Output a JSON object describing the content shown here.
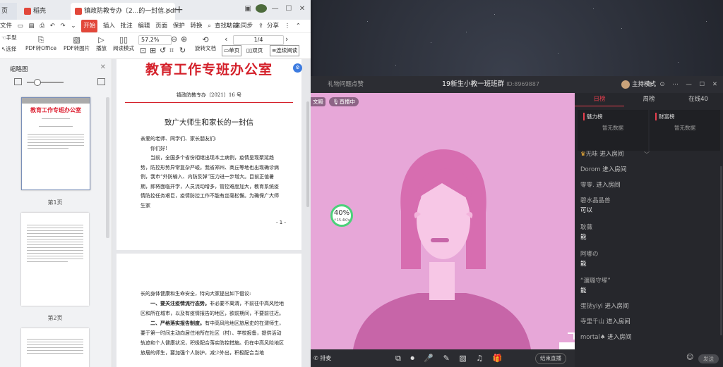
{
  "pdf_window": {
    "tabs": [
      {
        "label": "页"
      },
      {
        "label": "稻壳"
      },
      {
        "label": "镇政防教专办〔2...的一封信.pdf"
      }
    ],
    "menu": {
      "file": "文件",
      "start": "开始",
      "items": [
        "插入",
        "批注",
        "编辑",
        "页面",
        "保护",
        "转换"
      ],
      "search": "查找功能",
      "sync": "未同步",
      "share": "分享"
    },
    "toolbar": {
      "hand": "手型",
      "select": "选择",
      "pdf_to_office": "PDF转Office",
      "pdf_to_image": "PDF转图片",
      "play": "播放",
      "read_mode": "阅读模式",
      "zoom": "57.2%",
      "page": "1/4",
      "rotate": "旋转文档",
      "single": "单页",
      "double": "双页",
      "continuous": "连续阅读"
    },
    "sidebar": {
      "title": "缩略图",
      "thumb1_header": "教育工作专班办公室",
      "pages": [
        "第1页",
        "第2页"
      ]
    },
    "document": {
      "office": "教育工作专班办公室",
      "number": "镇政防教专办〔2021〕16 号",
      "title": "致广大师生和家长的一封信",
      "salutation": "亲爱的老师、同学们、家长朋友们:",
      "greeting": "你们好!",
      "para": "当前，全国多个省份相继出现本土病例，疫情呈现聚延趋势，防控形势异常复杂严峻。我省郑州、商丘等地也出现确诊病例，我市“外防输入、内防反弹”压力进一步增大。目前正值暑期，即将面临开学，人员流动增多，管控难度加大，教育系统疫情防控任务艰巨，疫情防控工作不能有丝毫松懈。为确保广大师生家",
      "page_num": "- 1 -",
      "p2_intro": "长的身体健康和生命安全，特向大家提出如下倡议:",
      "p2_item1_bold": "一、要关注疫情流行态势。",
      "p2_item1": "非必要不离渭，不前往中高风险地区和所在城市，以及有疫情报告的地区，欲前期间，不要前往近。",
      "p2_item2_bold": "二、严格落实报告制度。",
      "p2_item2": "有中高风险地区旅居史的在渭师生，要于第一时间主动向居住地所在社区（村）、学校报备，提供活动轨迹和个人健康状况，积极配合落实防控措施。仍在中高风险地区旅居的师生，要加强个人防护，减少外出，积极配合当地"
    }
  },
  "live_window": {
    "gift_tab": "礼物问题点赞",
    "title": "19新生小教一班班群",
    "id": "ID:8969887",
    "host_mode": "主持模式",
    "tag_left": "文殿",
    "tag_live": "直播中",
    "tabs": [
      "日榜",
      "周榜",
      "在线40"
    ],
    "rank_left": "魅力榜",
    "rank_right": "财富榜",
    "no_data": "暂无数据",
    "chat": [
      {
        "name": "无味",
        "text": "进入房间"
      },
      {
        "name": "Dorom",
        "text": "进入房间"
      },
      {
        "name": "零零.",
        "text": "进入房间"
      },
      {
        "name": "碧水晶晶兽",
        "body": "可以"
      },
      {
        "name": "耿薇",
        "body": "能"
      },
      {
        "name": "阿嘟の",
        "body": "能"
      },
      {
        "name": "“瀰璐守塚”",
        "body": "能"
      },
      {
        "name": "蛋挞yiyi",
        "text": "进入房间"
      },
      {
        "name": "寺里千山",
        "text": "进入房间"
      },
      {
        "name": "mortal",
        "text": "进入房间"
      }
    ],
    "net_percent": "40%",
    "net_speed": "↑15.4K/s",
    "bottom_left": "排麦",
    "end_live": "结束直播",
    "send": "发送"
  }
}
